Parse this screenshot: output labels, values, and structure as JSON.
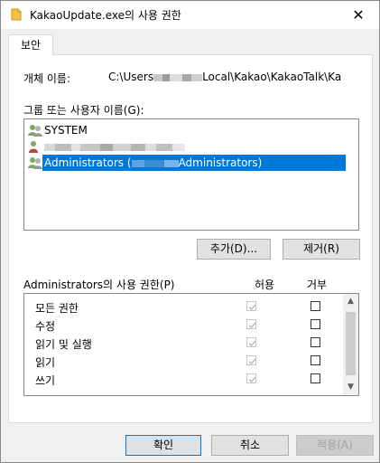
{
  "window": {
    "title": "KakaoUpdate.exe의 사용 권한",
    "close_glyph": "✕"
  },
  "tabs": [
    {
      "label": "보안",
      "selected": true
    }
  ],
  "object": {
    "label": "개체 이름:",
    "path_prefix": "C:\\Users",
    "path_suffix": "Local\\Kakao\\KakaoTalk\\Ka"
  },
  "group_list": {
    "label": "그룹 또는 사용자 이름(G):",
    "items": [
      {
        "name": "SYSTEM",
        "icon": "users-group-icon",
        "selected": false
      },
      {
        "name": "",
        "icon": "user-icon",
        "selected": false
      },
      {
        "name_prefix": "Administrators (",
        "name_suffix": "Administrators)",
        "icon": "users-group-icon",
        "selected": true
      }
    ]
  },
  "buttons": {
    "add": "추가(D)...",
    "remove": "제거(R)",
    "ok": "확인",
    "cancel": "취소",
    "apply": "적용(A)"
  },
  "permissions": {
    "label": "Administrators의 사용 권한(P)",
    "allow_header": "허용",
    "deny_header": "거부",
    "rows": [
      {
        "name": "모든 권한",
        "allow": true,
        "deny": false
      },
      {
        "name": "수정",
        "allow": true,
        "deny": false
      },
      {
        "name": "읽기 및 실행",
        "allow": true,
        "deny": false
      },
      {
        "name": "읽기",
        "allow": true,
        "deny": false
      },
      {
        "name": "쓰기",
        "allow": true,
        "deny": false
      }
    ]
  },
  "colors": {
    "selection": "#0078d7",
    "folder_icon": "#f3c443"
  }
}
